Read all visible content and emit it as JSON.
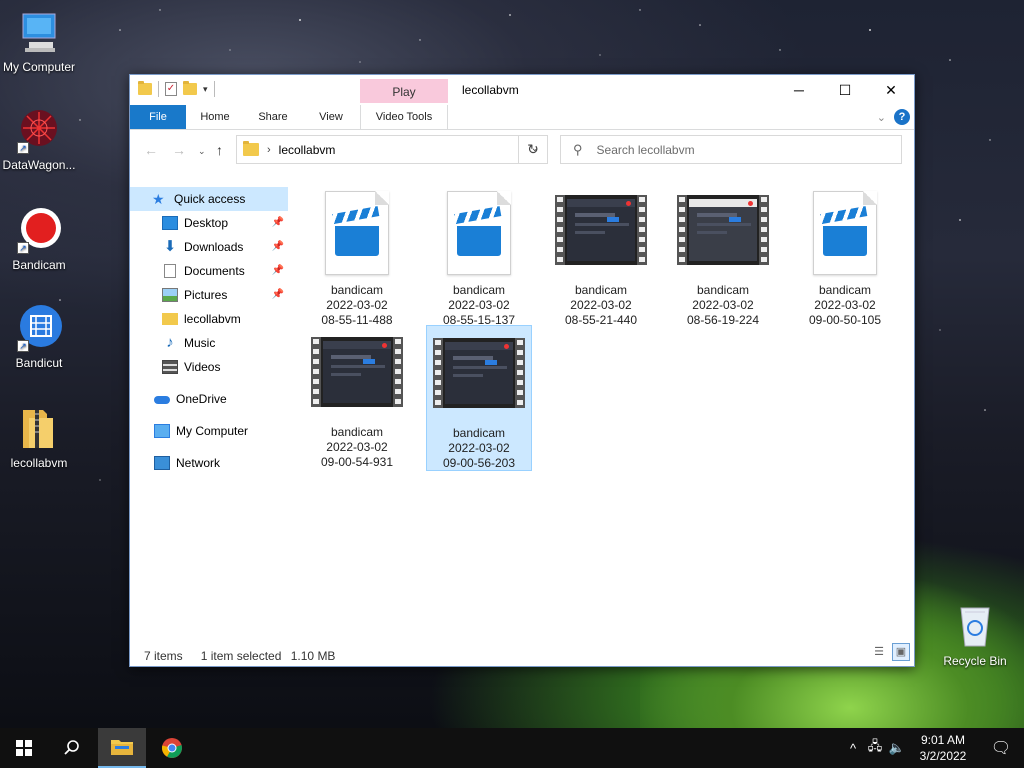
{
  "desktop": {
    "icons": [
      {
        "label": "My Computer",
        "icon": "computer-icon"
      },
      {
        "label": "DataWagon...",
        "icon": "datawagon-icon"
      },
      {
        "label": "Bandicam",
        "icon": "bandicam-icon"
      },
      {
        "label": "Bandicut",
        "icon": "bandicut-icon"
      },
      {
        "label": "lecollabvm",
        "icon": "zip-folder-icon"
      },
      {
        "label": "Recycle Bin",
        "icon": "recycle-bin-icon"
      }
    ]
  },
  "window": {
    "title": "lecollabvm",
    "contextual_tab": "Play",
    "ribbon_tabs": [
      "File",
      "Home",
      "Share",
      "View",
      "Video Tools"
    ],
    "caption": {
      "minimize": "─",
      "maximize": "☐",
      "close": "✕"
    },
    "address": {
      "crumb": "lecollabvm"
    },
    "search": {
      "placeholder": "Search lecollabvm"
    }
  },
  "navpane": {
    "quick_access": "Quick access",
    "items": [
      {
        "label": "Desktop",
        "icon": "desktop-icon",
        "pinned": true
      },
      {
        "label": "Downloads",
        "icon": "downloads-icon",
        "pinned": true
      },
      {
        "label": "Documents",
        "icon": "documents-icon",
        "pinned": true
      },
      {
        "label": "Pictures",
        "icon": "pictures-icon",
        "pinned": true
      },
      {
        "label": "lecollabvm",
        "icon": "folder-icon",
        "pinned": false
      },
      {
        "label": "Music",
        "icon": "music-icon",
        "pinned": false
      },
      {
        "label": "Videos",
        "icon": "videos-icon",
        "pinned": false
      }
    ],
    "onedrive": "OneDrive",
    "my_computer": "My Computer",
    "network": "Network"
  },
  "files": [
    {
      "name": "bandicam",
      "date": "2022-03-02",
      "time": "08-55-11-488",
      "kind": "doc"
    },
    {
      "name": "bandicam",
      "date": "2022-03-02",
      "time": "08-55-15-137",
      "kind": "doc"
    },
    {
      "name": "bandicam",
      "date": "2022-03-02",
      "time": "08-55-21-440",
      "kind": "video"
    },
    {
      "name": "bandicam",
      "date": "2022-03-02",
      "time": "08-56-19-224",
      "kind": "video-light"
    },
    {
      "name": "bandicam",
      "date": "2022-03-02",
      "time": "09-00-50-105",
      "kind": "doc"
    },
    {
      "name": "bandicam",
      "date": "2022-03-02",
      "time": "09-00-54-931",
      "kind": "video"
    },
    {
      "name": "bandicam",
      "date": "2022-03-02",
      "time": "09-00-56-203",
      "kind": "video",
      "selected": true
    }
  ],
  "status": {
    "count": "7 items",
    "selection": "1 item selected",
    "size": "1.10 MB"
  },
  "taskbar": {
    "time": "9:01 AM",
    "date": "3/2/2022"
  },
  "colors": {
    "accent": "#1979ca",
    "selection": "#cce8ff",
    "contextual": "#f9c9dc"
  }
}
